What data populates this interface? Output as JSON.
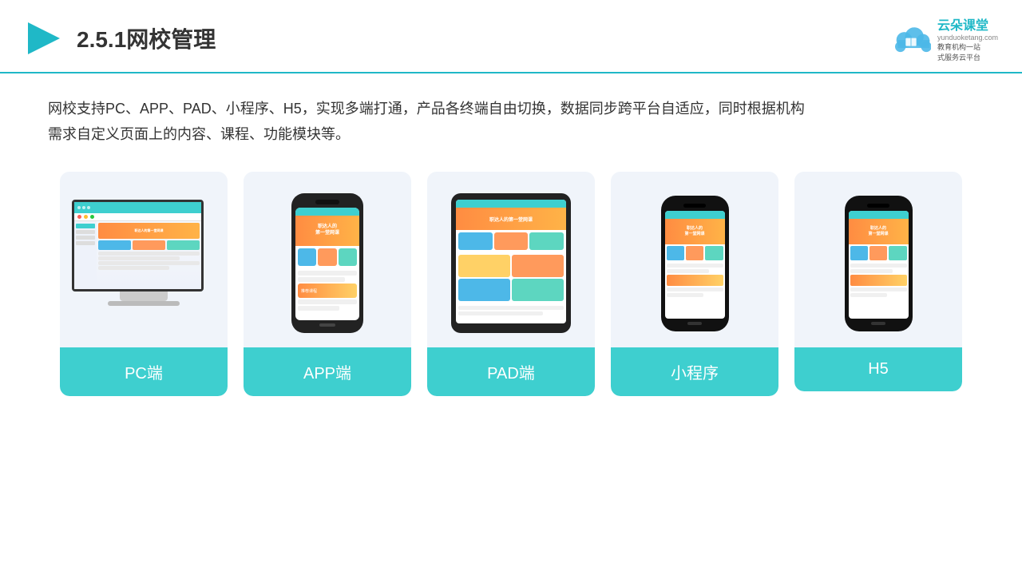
{
  "header": {
    "title": "2.5.1网校管理",
    "logo_name": "云朵课堂",
    "logo_sub": "yunduoketang.com",
    "logo_tagline": "教育机构一站\n式服务云平台"
  },
  "description": "网校支持PC、APP、PAD、小程序、H5，实现多端打通，产品各终端自由切换，数据同步跨平台自适应，同时根据机构\n需求自定义页面上的内容、课程、功能模块等。",
  "cards": [
    {
      "id": "pc",
      "label": "PC端"
    },
    {
      "id": "app",
      "label": "APP端"
    },
    {
      "id": "pad",
      "label": "PAD端"
    },
    {
      "id": "miniapp",
      "label": "小程序"
    },
    {
      "id": "h5",
      "label": "H5"
    }
  ],
  "colors": {
    "teal": "#3ecfcf",
    "accent": "#1fb8c7",
    "bg_card": "#f0f4fa"
  }
}
